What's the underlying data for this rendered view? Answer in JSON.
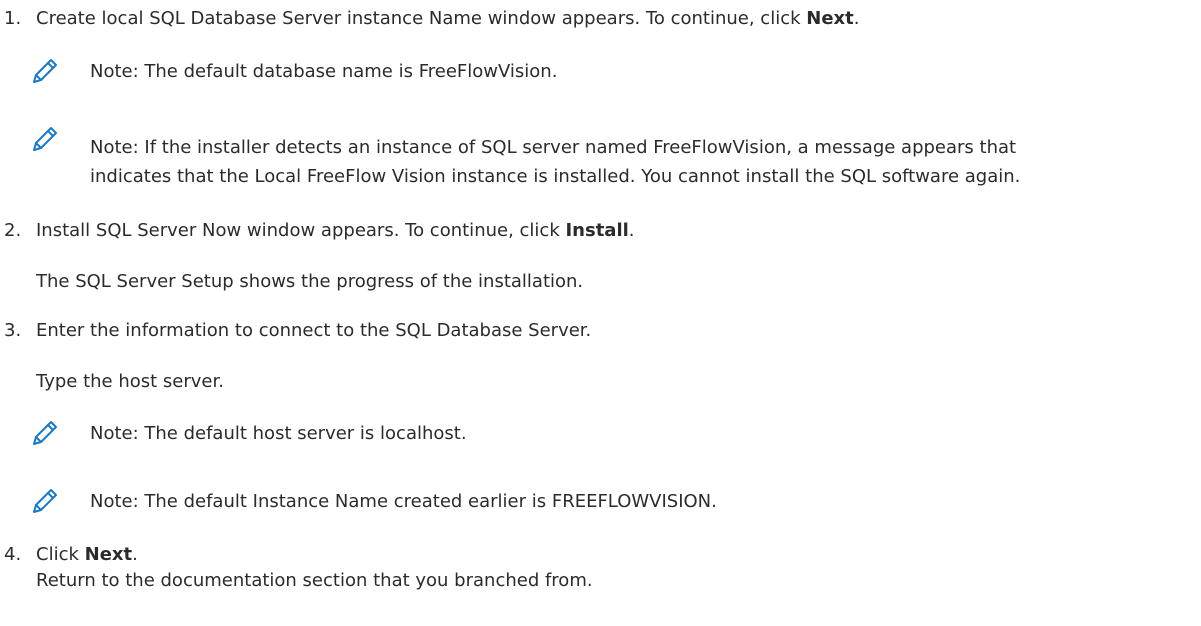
{
  "steps": [
    {
      "num": "1.",
      "pre": "Create local SQL Database Server instance Name window appears. To continue, click ",
      "bold": "Next",
      "post": "."
    },
    {
      "num": "2.",
      "pre": "Install SQL Server Now window appears. To continue, click ",
      "bold": "Install",
      "post": ".",
      "para": "The SQL Server Setup shows the progress of the installation."
    },
    {
      "num": "3.",
      "text": "Enter the information to connect to the SQL Database Server.",
      "para": "Type the host server."
    },
    {
      "num": "4.",
      "pre": "Click ",
      "bold": "Next",
      "post": ".",
      "para": "Return to the documentation section that you branched from."
    }
  ],
  "notes": {
    "n1": "Note: The default database name is FreeFlowVision.",
    "n2_line1": "Note: If the installer detects an instance of SQL server named FreeFlowVision, a message appears that",
    "n2_line2": "indicates that the Local FreeFlow Vision instance is installed. You cannot install the SQL software again.",
    "n3": "Note: The default host server is localhost.",
    "n4": "Note: The default Instance Name created earlier is FREEFLOWVISION."
  },
  "icon_color": "#1a78c8"
}
